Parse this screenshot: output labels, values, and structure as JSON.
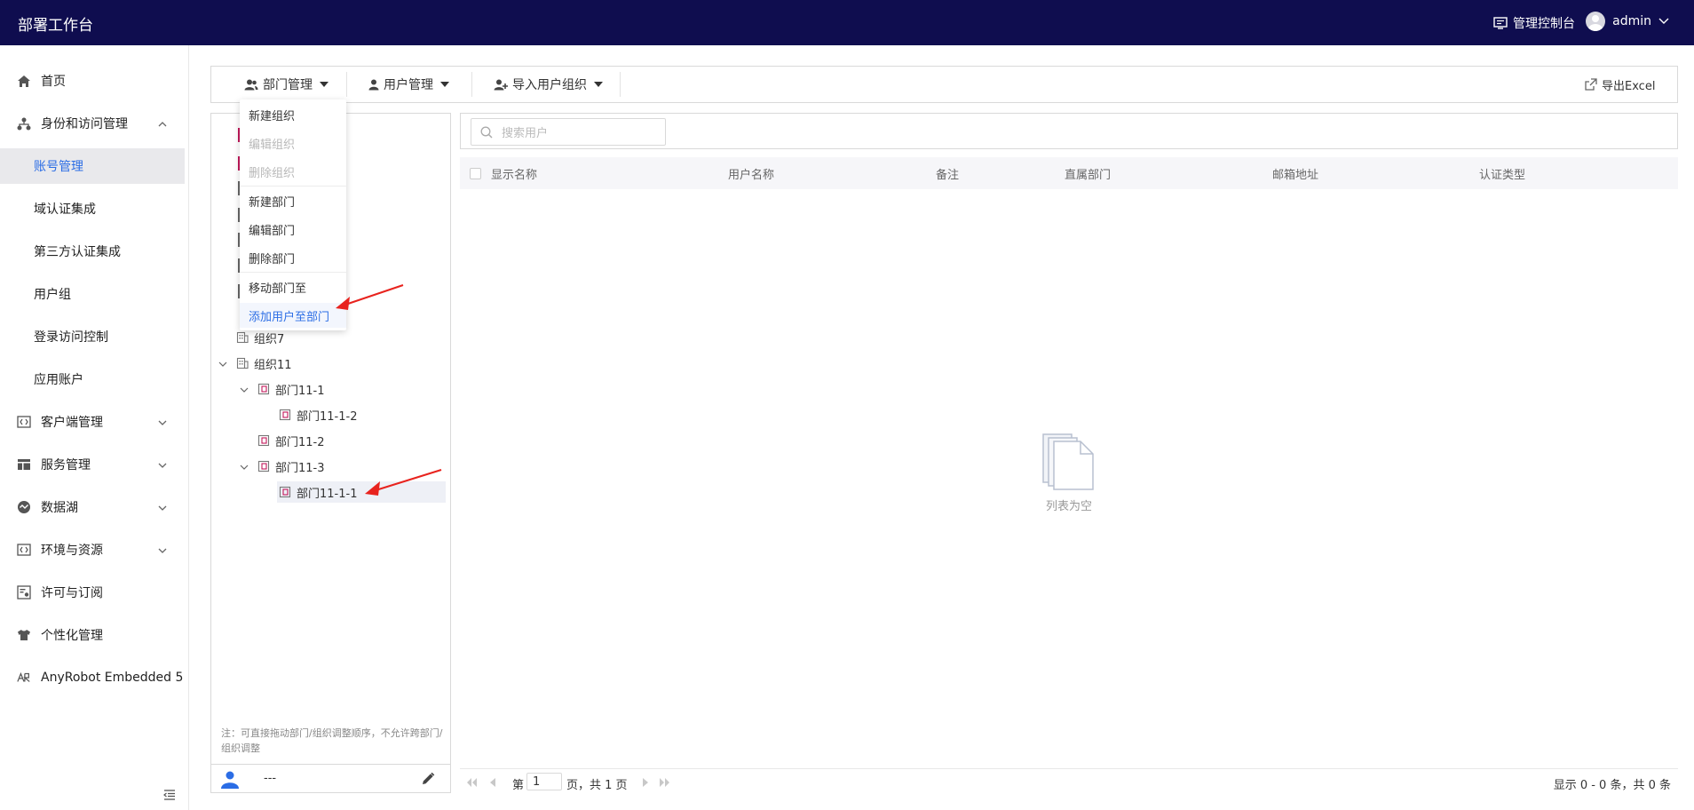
{
  "app": {
    "title": "部署工作台"
  },
  "topbar": {
    "console_label": "管理控制台",
    "user_label": "admin"
  },
  "sidebar": {
    "items": [
      {
        "label": "首页",
        "icon": "home-icon"
      },
      {
        "label": "身份和访问管理",
        "icon": "org-icon",
        "expanded": true
      },
      {
        "label": "账号管理",
        "active": true
      },
      {
        "label": "域认证集成"
      },
      {
        "label": "第三方认证集成"
      },
      {
        "label": "用户组"
      },
      {
        "label": "登录访问控制"
      },
      {
        "label": "应用账户"
      },
      {
        "label": "客户端管理",
        "icon": "code-icon"
      },
      {
        "label": "服务管理",
        "icon": "layout-icon"
      },
      {
        "label": "数据湖",
        "icon": "lake-icon"
      },
      {
        "label": "环境与资源",
        "icon": "code-icon"
      },
      {
        "label": "许可与订阅",
        "icon": "license-icon"
      },
      {
        "label": "个性化管理",
        "icon": "shirt-icon"
      },
      {
        "label": "AnyRobot Embedded 5",
        "icon": "anyrobot-icon"
      }
    ]
  },
  "toolbar": {
    "dept_manage": "部门管理",
    "user_manage": "用户管理",
    "import_group": "导入用户组织",
    "export_excel": "导出Excel"
  },
  "dropdown": {
    "items": [
      {
        "label": "新建组织",
        "disabled": false
      },
      {
        "label": "编辑组织",
        "disabled": true
      },
      {
        "label": "删除组织",
        "disabled": true
      },
      {
        "label": "新建部门",
        "disabled": false
      },
      {
        "label": "编辑部门",
        "disabled": false
      },
      {
        "label": "删除部门",
        "disabled": false
      },
      {
        "label": "移动部门至",
        "disabled": false
      },
      {
        "label": "添加用户至部门",
        "highlight": true
      }
    ]
  },
  "tree": {
    "nodes": [
      {
        "label": "组织7",
        "type": "org"
      },
      {
        "label": "组织11",
        "type": "org",
        "expanded": true
      },
      {
        "label": "部门11-1",
        "type": "dept",
        "expanded": true
      },
      {
        "label": "部门11-1-2",
        "type": "dept"
      },
      {
        "label": "部门11-2",
        "type": "dept"
      },
      {
        "label": "部门11-3",
        "type": "dept",
        "expanded": true
      },
      {
        "label": "部门11-1-1",
        "type": "dept",
        "selected": true
      }
    ],
    "note": "注：可直接拖动部门/组织调整顺序，不允许跨部门/组织调整",
    "footer_value": "---"
  },
  "list": {
    "search_placeholder": "搜索用户",
    "columns": [
      "显示名称",
      "用户名称",
      "备注",
      "直属部门",
      "邮箱地址",
      "认证类型"
    ],
    "empty_text": "列表为空"
  },
  "pager": {
    "page_prefix": "第",
    "page_value": "1",
    "page_suffix": "页，共 1 页",
    "summary": "显示 0 - 0 条，共 0 条"
  },
  "colors": {
    "topbar": "#0f0d4f",
    "accent": "#2b6de5",
    "arrow": "#e8231e"
  }
}
